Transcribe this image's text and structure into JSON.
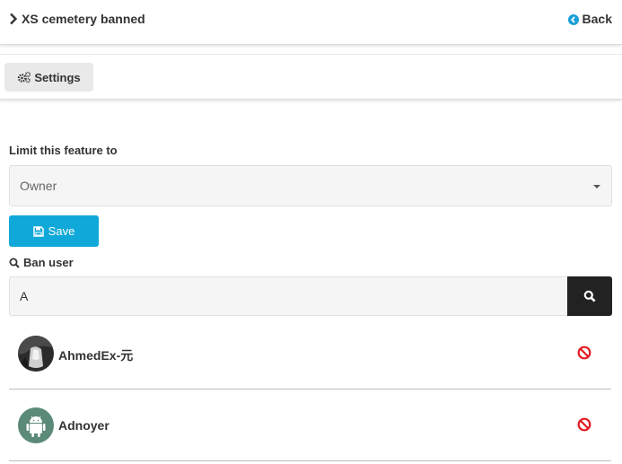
{
  "header": {
    "title": "XS cemetery banned",
    "back_label": "Back"
  },
  "toolbar": {
    "settings_label": "Settings"
  },
  "form": {
    "limit_label": "Limit this feature to",
    "limit_value": "Owner",
    "save_label": "Save",
    "ban_label": "Ban user",
    "search_value": "A"
  },
  "results": [
    {
      "name": "AhmedEx-元",
      "avatar": "photo-avatar"
    },
    {
      "name": "Adnoyer",
      "avatar": "android-avatar"
    }
  ],
  "colors": {
    "accent": "#0fa8d8",
    "ban": "#e31b23",
    "search_button": "#222222",
    "android_avatar_bg": "#5b8a78"
  }
}
